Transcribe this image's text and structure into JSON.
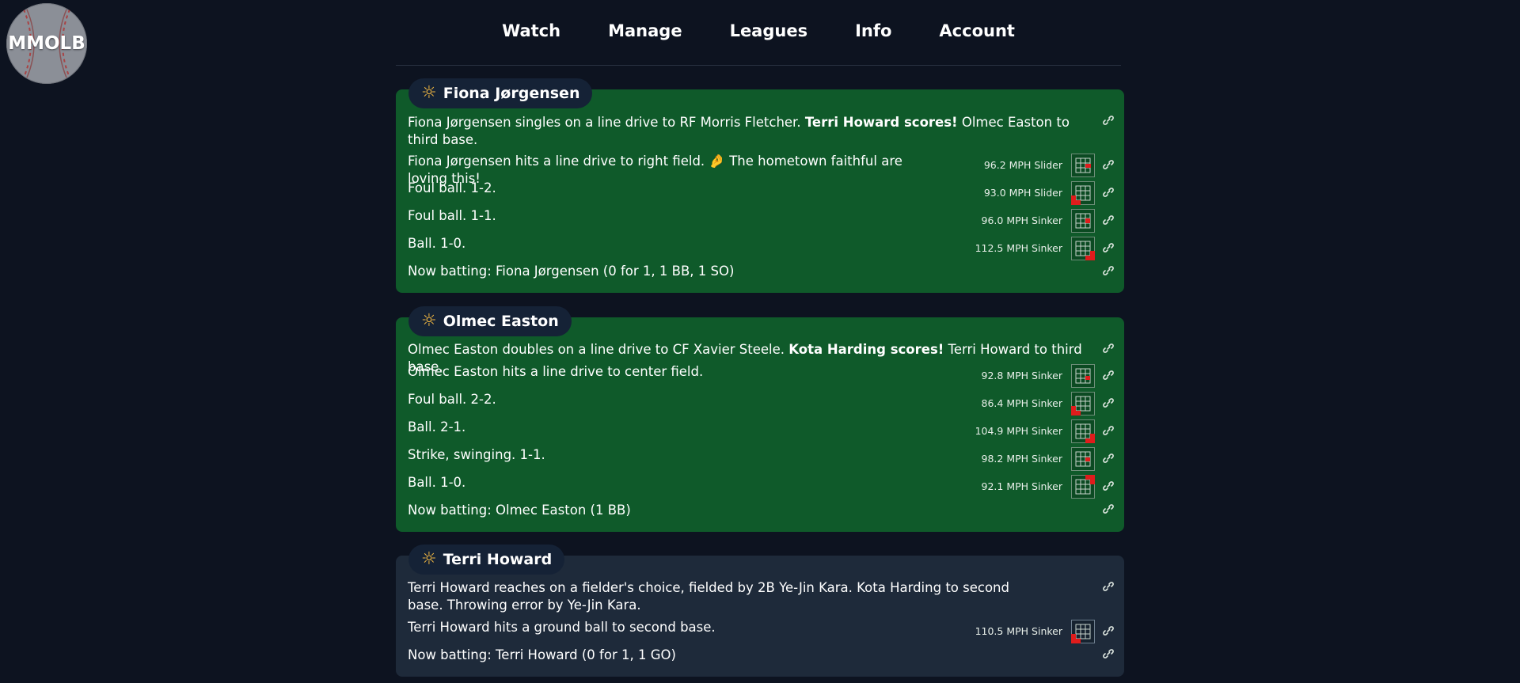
{
  "logo": {
    "text": "MMOLB"
  },
  "nav": [
    {
      "label": "Watch"
    },
    {
      "label": "Manage"
    },
    {
      "label": "Leagues"
    },
    {
      "label": "Info"
    },
    {
      "label": "Account"
    }
  ],
  "colors": {
    "page_bg": "#0d1320",
    "card_green": "#0f5a2a",
    "card_dark": "#1e2a3a",
    "sun": "#f4b942",
    "zone_mark": "#e01c1c"
  },
  "cards": [
    {
      "player": "Fiona Jørgensen",
      "icon": "sun-icon",
      "result_pre": "Fiona Jørgensen singles on a line drive to RF Morris Fletcher. ",
      "result_bold": "Terri Howard scores!",
      "result_post": " Olmec Easton to third base.",
      "pitches": [
        {
          "text": "Fiona Jørgensen hits a line drive to right field. 🤌 The hometown faithful are loving this!",
          "pitch": "96.2 MPH Slider",
          "zone": "mid-right"
        },
        {
          "text": "Foul ball. 1-2.",
          "pitch": "93.0 MPH Slider",
          "zone": "low-left"
        },
        {
          "text": "Foul ball. 1-1.",
          "pitch": "96.0 MPH Sinker",
          "zone": "mid-right"
        },
        {
          "text": "Ball. 1-0.",
          "pitch": "112.5 MPH Sinker",
          "zone": "low-right-out"
        }
      ],
      "now_batting": "Now batting: Fiona Jørgensen (0 for 1, 1 BB, 1 SO)"
    },
    {
      "player": "Olmec Easton",
      "icon": "sun-icon",
      "result_pre": "Olmec Easton doubles on a line drive to CF Xavier Steele. ",
      "result_bold": "Kota Harding scores!",
      "result_post": " Terri Howard to third base.",
      "pitches": [
        {
          "text": "Olmec Easton hits a line drive to center field.",
          "pitch": "92.8 MPH Sinker",
          "zone": "mid-right"
        },
        {
          "text": "Foul ball. 2-2.",
          "pitch": "86.4 MPH Sinker",
          "zone": "low-left"
        },
        {
          "text": "Ball. 2-1.",
          "pitch": "104.9 MPH Sinker",
          "zone": "low-right-out"
        },
        {
          "text": "Strike, swinging. 1-1.",
          "pitch": "98.2 MPH Sinker",
          "zone": "mid-right"
        },
        {
          "text": "Ball. 1-0.",
          "pitch": "92.1 MPH Sinker",
          "zone": "high-right-out"
        }
      ],
      "now_batting": "Now batting: Olmec Easton (1 BB)"
    },
    {
      "player": "Terri Howard",
      "icon": "sun-icon",
      "result_pre": "Terri Howard reaches on a fielder's choice, fielded by 2B Ye-Jin Kara. Kota Harding to second base. Throwing error by Ye-Jin Kara.",
      "result_bold": "",
      "result_post": "",
      "pitches": [
        {
          "text": "Terri Howard hits a ground ball to second base.",
          "pitch": "110.5 MPH Sinker",
          "zone": "low-left-out"
        }
      ],
      "now_batting": "Now batting: Terri Howard (0 for 1, 1 GO)"
    }
  ]
}
